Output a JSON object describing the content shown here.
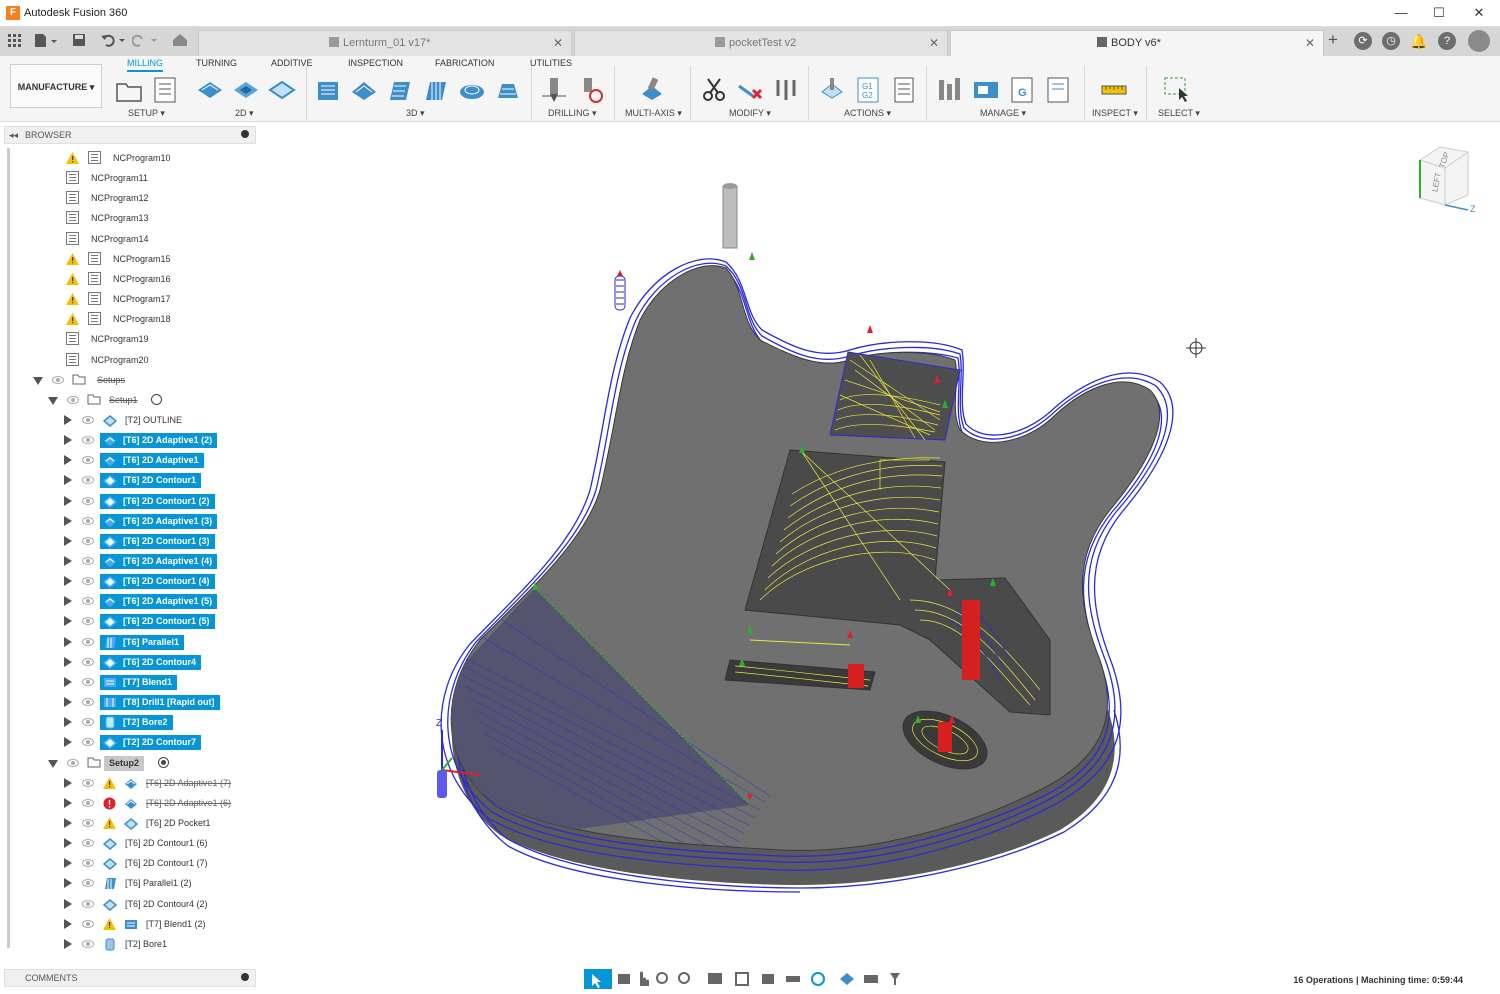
{
  "app": {
    "title": "Autodesk Fusion 360",
    "logo_letter": "F"
  },
  "window_controls": {
    "minimize": "—",
    "maximize": "☐",
    "close": "✕"
  },
  "tabs": [
    {
      "label": "Lernturm_01 v17*",
      "active": false
    },
    {
      "label": "pocketTest v2",
      "active": false
    },
    {
      "label": "BODY v6*",
      "active": true
    }
  ],
  "workspace": {
    "label": "MANUFACTURE"
  },
  "ribbon_tabs": [
    "MILLING",
    "TURNING",
    "ADDITIVE",
    "INSPECTION",
    "FABRICATION",
    "UTILITIES"
  ],
  "ribbon_groups": [
    "SETUP",
    "2D",
    "3D",
    "DRILLING",
    "MULTI-AXIS",
    "MODIFY",
    "ACTIONS",
    "MANAGE",
    "INSPECT",
    "SELECT"
  ],
  "browser": {
    "title": "BROWSER",
    "nc_programs": [
      {
        "label": "NCProgram10",
        "warn": true
      },
      {
        "label": "NCProgram11",
        "warn": false
      },
      {
        "label": "NCProgram12",
        "warn": false
      },
      {
        "label": "NCProgram13",
        "warn": false
      },
      {
        "label": "NCProgram14",
        "warn": false
      },
      {
        "label": "NCProgram15",
        "warn": true
      },
      {
        "label": "NCProgram16",
        "warn": true
      },
      {
        "label": "NCProgram17",
        "warn": true
      },
      {
        "label": "NCProgram18",
        "warn": true
      },
      {
        "label": "NCProgram19",
        "warn": false
      },
      {
        "label": "NCProgram20",
        "warn": false
      }
    ],
    "setups_label": "Setups",
    "setup1": {
      "label": "Setup1",
      "operations": [
        {
          "label": "[T2] OUTLINE",
          "selected": false
        },
        {
          "label": "[T6] 2D Adaptive1 (2)",
          "selected": true
        },
        {
          "label": "[T6] 2D Adaptive1",
          "selected": true
        },
        {
          "label": "[T6] 2D Contour1",
          "selected": true
        },
        {
          "label": "[T6] 2D Contour1 (2)",
          "selected": true
        },
        {
          "label": "[T6] 2D Adaptive1 (3)",
          "selected": true
        },
        {
          "label": "[T6] 2D Contour1 (3)",
          "selected": true
        },
        {
          "label": "[T6] 2D Adaptive1 (4)",
          "selected": true
        },
        {
          "label": "[T6] 2D Contour1 (4)",
          "selected": true
        },
        {
          "label": "[T6] 2D Adaptive1 (5)",
          "selected": true
        },
        {
          "label": "[T6] 2D Contour1 (5)",
          "selected": true
        },
        {
          "label": "[T6] Parallel1",
          "selected": true
        },
        {
          "label": "[T6] 2D Contour4",
          "selected": true
        },
        {
          "label": "[T7] Blend1",
          "selected": true
        },
        {
          "label": "[T8] Drill1 [Rapid out]",
          "selected": true
        },
        {
          "label": "[T2] Bore2",
          "selected": true
        },
        {
          "label": "[T2] 2D Contour7",
          "selected": true
        }
      ]
    },
    "setup2": {
      "label": "Setup2",
      "operations": [
        {
          "label": "[T6] 2D Adaptive1 (7)",
          "status": "warn",
          "strike": true
        },
        {
          "label": "[T6] 2D Adaptive1 (6)",
          "status": "error",
          "strike": true
        },
        {
          "label": "[T6] 2D Pocket1",
          "status": "warn",
          "strike": false
        },
        {
          "label": "[T6] 2D Contour1 (6)",
          "status": "none",
          "strike": false
        },
        {
          "label": "[T6] 2D Contour1 (7)",
          "status": "none",
          "strike": false
        },
        {
          "label": "[T6] Parallel1 (2)",
          "status": "none",
          "strike": false
        },
        {
          "label": "[T6] 2D Contour4 (2)",
          "status": "none",
          "strike": false
        },
        {
          "label": "[T7] Blend1 (2)",
          "status": "warn",
          "strike": false
        },
        {
          "label": "[T2] Bore1",
          "status": "none",
          "strike": false
        }
      ]
    }
  },
  "comments": {
    "label": "COMMENTS"
  },
  "status_bar": {
    "text": "16 Operations | Machining time: 0:59:44"
  },
  "viewcube": {
    "face_top": "TOP",
    "face_left": "LEFT",
    "axis": "Z"
  },
  "triad": {
    "axis": "Z"
  },
  "colors": {
    "accent": "#0696d7",
    "toolpath_blue": "#2a2ad8",
    "toolpath_yellow": "#e8e83a",
    "body": "#6e6e6e",
    "warn": "#f2c200",
    "error": "#e0202c"
  }
}
